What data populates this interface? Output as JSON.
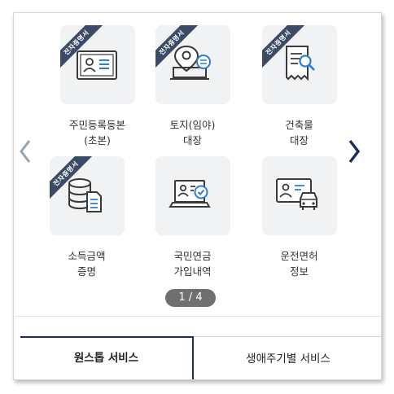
{
  "services": [
    {
      "name_line1": "주민등록등본",
      "name_line2": "(초본)",
      "ribbon": "전자증명서",
      "icon": "id-card-icon"
    },
    {
      "name_line1": "토지(임야)",
      "name_line2": "대장",
      "ribbon": "전자증명서",
      "icon": "land-map-icon"
    },
    {
      "name_line1": "건축물",
      "name_line2": "대장",
      "ribbon": "전자증명서",
      "icon": "building-document-icon"
    },
    {
      "name_line1": "소득금액",
      "name_line2": "증명",
      "ribbon": "전자증명서",
      "icon": "income-database-icon"
    },
    {
      "name_line1": "국민연금",
      "name_line2": "가입내역",
      "ribbon": "",
      "icon": "pension-laptop-icon"
    },
    {
      "name_line1": "운전면허",
      "name_line2": "정보",
      "ribbon": "",
      "icon": "driver-license-icon"
    }
  ],
  "pager": {
    "text": "1 / 4"
  },
  "nav": {
    "prev_icon": "chevron-left-icon",
    "next_icon": "chevron-right-icon"
  },
  "tabs": {
    "onestop": "원스톱 서비스",
    "lifecycle": "생애주기별 서비스"
  },
  "colors": {
    "ribbon": "#3d4a66",
    "icon_stroke": "#3a3a3a",
    "icon_accent": "#2a7fd4",
    "active_tab": "#1d2d5a"
  }
}
